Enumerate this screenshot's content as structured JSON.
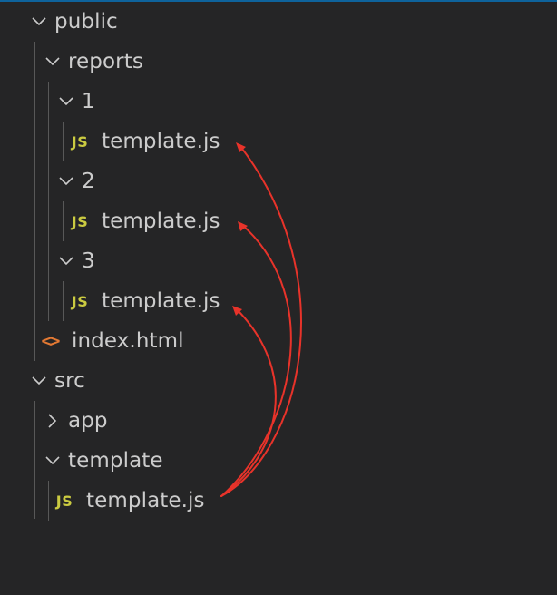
{
  "explorer": {
    "public_label": "public",
    "reports_label": "reports",
    "folder1_label": "1",
    "folder1_file": "template.js",
    "folder2_label": "2",
    "folder2_file": "template.js",
    "folder3_label": "3",
    "folder3_file": "template.js",
    "index_file": "index.html",
    "src_label": "src",
    "app_label": "app",
    "template_folder_label": "template",
    "template_file": "template.js"
  },
  "icons": {
    "js_icon": "JS",
    "html_icon": "<>",
    "expanded": "chevron-down-icon",
    "collapsed": "chevron-right-icon"
  },
  "colors": {
    "background": "#252526",
    "text": "#cccccc",
    "js_icon": "#cbcb41",
    "html_icon": "#e37933",
    "annotation_arrow": "#e8332a",
    "top_accent": "#0e639c"
  }
}
